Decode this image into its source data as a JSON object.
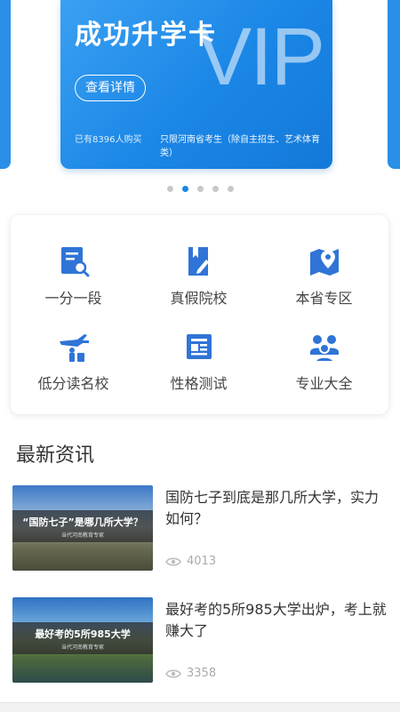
{
  "banner": {
    "title": "成功升学卡",
    "vip_text": "VIP",
    "button_label": "查看详情",
    "purchase_count": "已有8396人购买",
    "note": "只限河南省考生（除自主招生、艺术体育类）",
    "accent_color": "#1a86e6"
  },
  "carousel": {
    "total": 5,
    "active_index": 1
  },
  "features": {
    "items": [
      {
        "label": "一分一段",
        "icon": "search-document-icon"
      },
      {
        "label": "真假院校",
        "icon": "bookmark-edit-icon"
      },
      {
        "label": "本省专区",
        "icon": "map-pin-icon"
      },
      {
        "label": "低分读名校",
        "icon": "airplane-traveler-icon"
      },
      {
        "label": "性格测试",
        "icon": "newspaper-icon"
      },
      {
        "label": "专业大全",
        "icon": "people-group-icon"
      }
    ],
    "icon_color": "#2f74d6"
  },
  "news": {
    "section_title": "最新资讯",
    "items": [
      {
        "title": "国防七子到底是那几所大学，实力如何？",
        "thumb_text": "“国防七子”是哪几所大学？",
        "thumb_sub": "当代河南教育专家",
        "views": "4013"
      },
      {
        "title": "最好考的5所985大学出炉，考上就赚大了",
        "thumb_text": "最好考的5所985大学",
        "thumb_sub": "当代河南教育专家",
        "views": "3358"
      }
    ]
  }
}
